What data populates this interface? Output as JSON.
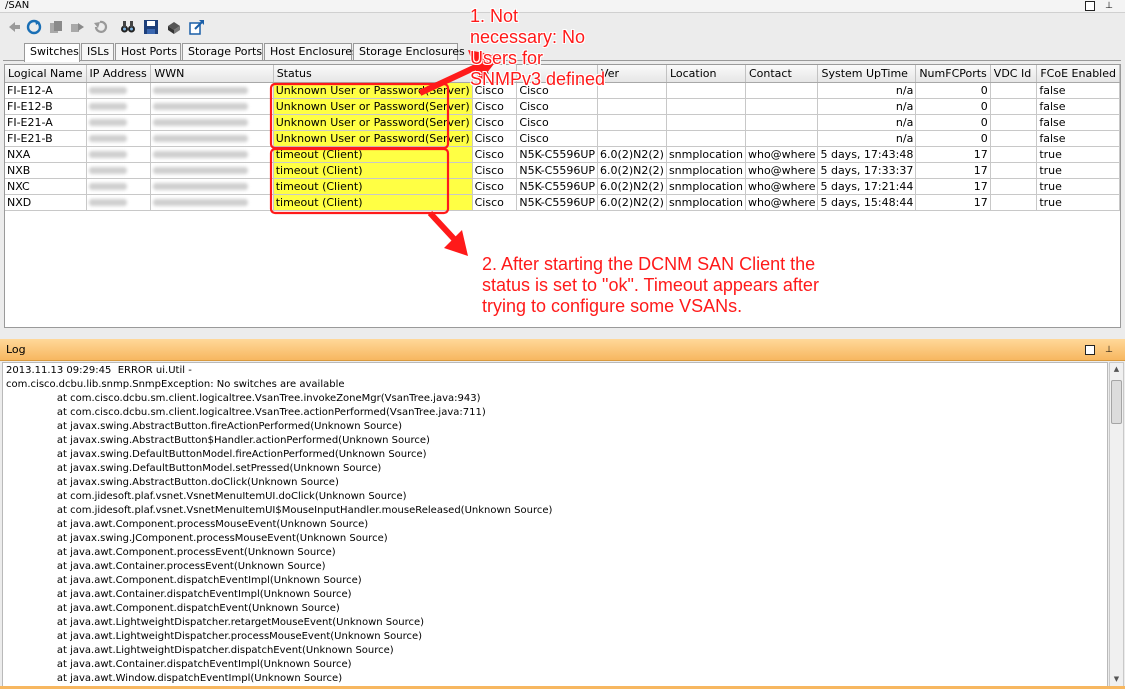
{
  "window": {
    "title": "/SAN"
  },
  "toolbar": {
    "icons": [
      "back-icon",
      "refresh-icon",
      "copy-icon",
      "forward-icon",
      "undo-icon",
      "binoculars-icon",
      "save-icon",
      "print-icon",
      "export-icon"
    ]
  },
  "tabs": [
    "Switches",
    "ISLs",
    "Host Ports",
    "Storage Ports",
    "Host Enclosures",
    "Storage Enclosures"
  ],
  "table": {
    "columns": [
      "Logical Name",
      "IP Address",
      "WWN",
      "Status",
      "Ve",
      "",
      "Ver",
      "Location",
      "Contact",
      "System UpTime",
      "NumFCPorts",
      "VDC Id",
      "FCoE Enabled"
    ],
    "rows": [
      [
        "FI-E12-A",
        "",
        "",
        "Unknown User or Password(Server)",
        "Cisco",
        "Cisco",
        "",
        "",
        "",
        "n/a",
        "0",
        "",
        "false"
      ],
      [
        "FI-E12-B",
        "",
        "",
        "Unknown User or Password(Server)",
        "Cisco",
        "Cisco",
        "",
        "",
        "",
        "n/a",
        "0",
        "",
        "false"
      ],
      [
        "FI-E21-A",
        "",
        "",
        "Unknown User or Password(Server)",
        "Cisco",
        "Cisco",
        "",
        "",
        "",
        "n/a",
        "0",
        "",
        "false"
      ],
      [
        "FI-E21-B",
        "",
        "",
        "Unknown User or Password(Server)",
        "Cisco",
        "Cisco",
        "",
        "",
        "",
        "n/a",
        "0",
        "",
        "false"
      ],
      [
        "NXA",
        "",
        "",
        "timeout (Client)",
        "Cisco",
        "N5K-C5596UP",
        "6.0(2)N2(2)",
        "snmplocation",
        "who@where",
        "5 days, 17:43:48",
        "17",
        "",
        "true"
      ],
      [
        "NXB",
        "",
        "",
        "timeout (Client)",
        "Cisco",
        "N5K-C5596UP",
        "6.0(2)N2(2)",
        "snmplocation",
        "who@where",
        "5 days, 17:33:37",
        "17",
        "",
        "true"
      ],
      [
        "NXC",
        "",
        "",
        "timeout (Client)",
        "Cisco",
        "N5K-C5596UP",
        "6.0(2)N2(2)",
        "snmplocation",
        "who@where",
        "5 days, 17:21:44",
        "17",
        "",
        "true"
      ],
      [
        "NXD",
        "",
        "",
        "timeout (Client)",
        "Cisco",
        "N5K-C5596UP",
        "6.0(2)N2(2)",
        "snmplocation",
        "who@where",
        "5 days, 15:48:44",
        "17",
        "",
        "true"
      ]
    ]
  },
  "log": {
    "title": "Log",
    "lines": [
      "2013.11.13 09:29:45  ERROR ui.Util -",
      "com.cisco.dcbu.lib.snmp.SnmpException: No switches are available",
      "\t\tat com.cisco.dcbu.sm.client.logicaltree.VsanTree.invokeZoneMgr(VsanTree.java:943)",
      "\t\tat com.cisco.dcbu.sm.client.logicaltree.VsanTree.actionPerformed(VsanTree.java:711)",
      "\t\tat javax.swing.AbstractButton.fireActionPerformed(Unknown Source)",
      "\t\tat javax.swing.AbstractButton$Handler.actionPerformed(Unknown Source)",
      "\t\tat javax.swing.DefaultButtonModel.fireActionPerformed(Unknown Source)",
      "\t\tat javax.swing.DefaultButtonModel.setPressed(Unknown Source)",
      "\t\tat javax.swing.AbstractButton.doClick(Unknown Source)",
      "\t\tat com.jidesoft.plaf.vsnet.VsnetMenuItemUI.doClick(Unknown Source)",
      "\t\tat com.jidesoft.plaf.vsnet.VsnetMenuItemUI$MouseInputHandler.mouseReleased(Unknown Source)",
      "\t\tat java.awt.Component.processMouseEvent(Unknown Source)",
      "\t\tat javax.swing.JComponent.processMouseEvent(Unknown Source)",
      "\t\tat java.awt.Component.processEvent(Unknown Source)",
      "\t\tat java.awt.Container.processEvent(Unknown Source)",
      "\t\tat java.awt.Component.dispatchEventImpl(Unknown Source)",
      "\t\tat java.awt.Container.dispatchEventImpl(Unknown Source)",
      "\t\tat java.awt.Component.dispatchEvent(Unknown Source)",
      "\t\tat java.awt.LightweightDispatcher.retargetMouseEvent(Unknown Source)",
      "\t\tat java.awt.LightweightDispatcher.processMouseEvent(Unknown Source)",
      "\t\tat java.awt.LightweightDispatcher.dispatchEvent(Unknown Source)",
      "\t\tat java.awt.Container.dispatchEventImpl(Unknown Source)",
      "\t\tat java.awt.Window.dispatchEventImpl(Unknown Source)"
    ]
  },
  "annotations": {
    "note1": [
      "1. Not",
      "necessary: No",
      "Users for",
      "SNMPv3 defined"
    ],
    "note2": [
      "2. After starting the DCNM SAN Client the",
      "status is set to \"ok\". Timeout appears after",
      "trying to configure some VSANs."
    ]
  },
  "colors": {
    "status_highlight": "#ffff44",
    "annotation": "#ff1a1a",
    "log_header": "#f7b760"
  }
}
